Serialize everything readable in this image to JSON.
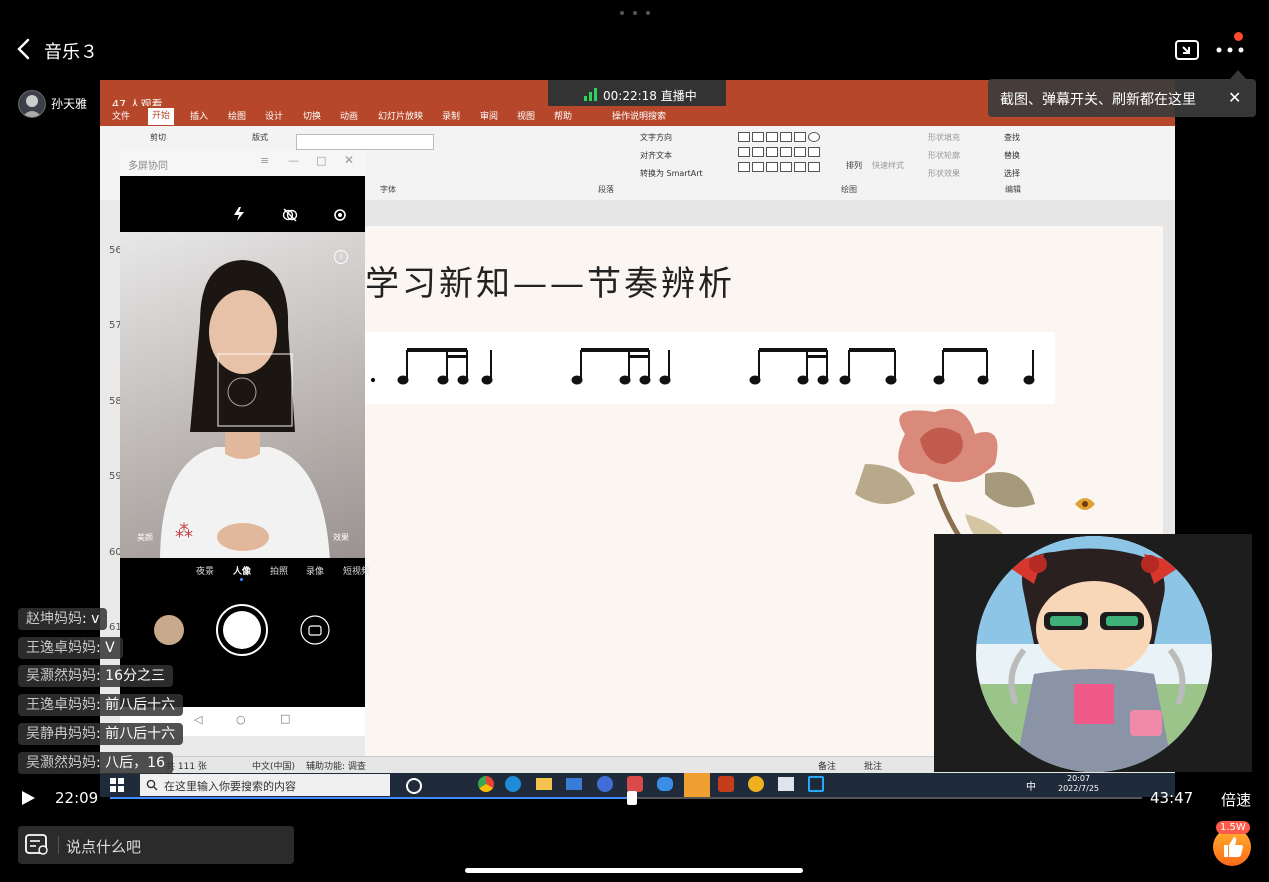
{
  "header": {
    "title": "音乐３",
    "host_name": "孙天雅",
    "tooltip": "截图、弹幕开关、刷新都在这里"
  },
  "screen_share": {
    "viewers": "47 人观看",
    "live_timer": "00:22:18 直播中",
    "ribbon_tabs": [
      "文件",
      "开始",
      "插入",
      "绘图",
      "设计",
      "切换",
      "动画",
      "幻灯片放映",
      "录制",
      "审阅",
      "视图",
      "帮助",
      "操作说明搜索"
    ],
    "ribbon_groups": {
      "clipboard_cut": "剪切",
      "layout": "版式",
      "font_label": "字体",
      "paragraph_label": "段落",
      "drawing_label": "绘图",
      "editing_label": "编辑",
      "text_direction": "文字方向",
      "align_text": "对齐文本",
      "smartart": "转换为 SmartArt",
      "arrange": "排列",
      "quick_styles": "快速样式",
      "shape_fill": "形状填充",
      "shape_outline": "形状轮廓",
      "shape_effects": "形状效果",
      "find": "查找",
      "replace": "替换",
      "select": "选择"
    },
    "slide_numbers": [
      "56",
      "57",
      "58",
      "59",
      "60",
      "61"
    ],
    "slide_title": "学习新知——节奏辨析",
    "status_bar": {
      "slide_count": "共 111 张",
      "language": "中文(中国)",
      "accessibility": "辅助功能: 调查",
      "notes": "备注",
      "comments": "批注"
    },
    "taskbar": {
      "search_placeholder": "在这里输入你要搜索的内容",
      "time": "20:07",
      "date": "2022/7/25",
      "ime": "中"
    }
  },
  "phone_window": {
    "title": "多屏协同",
    "modes": [
      "夜景",
      "人像",
      "拍照",
      "录像",
      "短视频"
    ],
    "active_mode": "人像",
    "beauty_label": "美颜",
    "effect_label": "效果"
  },
  "chat": [
    {
      "name": "赵坤妈妈",
      "text": "v"
    },
    {
      "name": "王逸卓妈妈",
      "text": "V"
    },
    {
      "name": "吴灏然妈妈",
      "text": "16分之三"
    },
    {
      "name": "王逸卓妈妈",
      "text": "前八后十六"
    },
    {
      "name": "吴静冉妈妈",
      "text": "前八后十六"
    },
    {
      "name": "吴灏然妈妈",
      "text": "八后，16"
    }
  ],
  "player": {
    "current_time": "22:09",
    "total_time": "43:47",
    "progress": 0.506,
    "speed_label": "倍速",
    "comment_placeholder": "说点什么吧",
    "like_count": "1.5W"
  },
  "colors": {
    "ppt_ribbon": "#b7472a",
    "progress": "#3f8cff",
    "live_green": "#2fd25a",
    "notify": "#ff4a2d"
  }
}
